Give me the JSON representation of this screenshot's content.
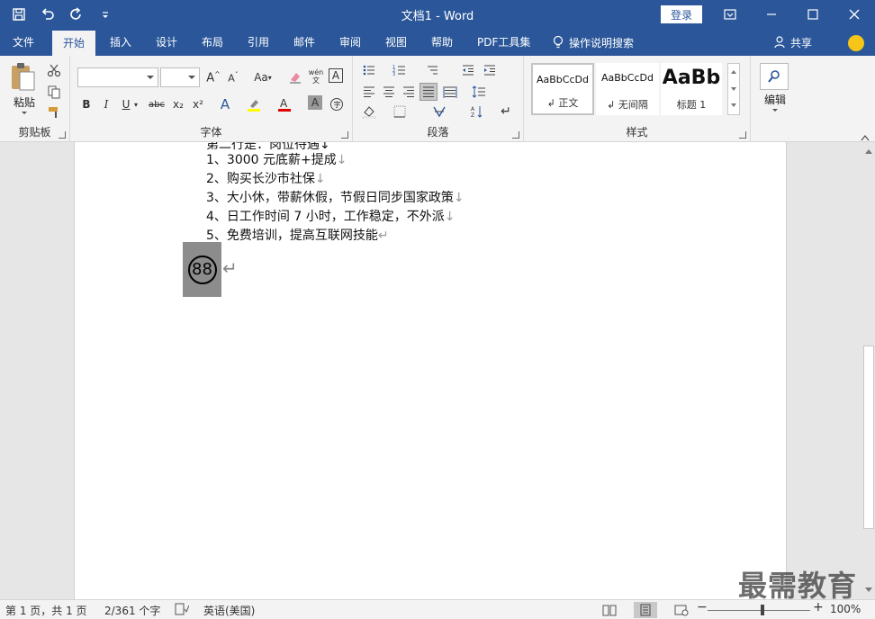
{
  "title_bar": {
    "title": "文档1  -  Word",
    "login_label": "登录"
  },
  "tabs": [
    "文件",
    "开始",
    "插入",
    "设计",
    "布局",
    "引用",
    "邮件",
    "审阅",
    "视图",
    "帮助",
    "PDF工具集"
  ],
  "active_tab": "开始",
  "tell_me": "操作说明搜索",
  "share_label": "共享",
  "ribbon": {
    "clipboard": {
      "paste_label": "粘贴",
      "group_label": "剪贴板"
    },
    "font": {
      "font_name": "",
      "font_size": "",
      "group_label": "字体",
      "aa_label": "Aa",
      "pinyin_label": "wén 文",
      "char_border": "A",
      "bold": "B",
      "italic": "I",
      "underline": "U",
      "strike": "abc",
      "subscript": "x₂",
      "superscript": "x²"
    },
    "paragraph": {
      "group_label": "段落"
    },
    "styles": {
      "group_label": "样式",
      "items": [
        {
          "sample": "AaBbCcDd",
          "name": "↲ 正文"
        },
        {
          "sample": "AaBbCcDd",
          "name": "↲ 无间隔"
        },
        {
          "sample": "AaBb",
          "name": "标题 1"
        }
      ]
    },
    "editing": {
      "label": "编辑"
    }
  },
  "document": {
    "cut_line": "第二行是：岗位待遇↓",
    "lines": [
      {
        "text": "1、3000 元底薪+提成",
        "mark": "↓"
      },
      {
        "text": "2、购买长沙市社保",
        "mark": "↓"
      },
      {
        "text": "3、大小休，带薪休假，节假日同步国家政策",
        "mark": "↓"
      },
      {
        "text": "4、日工作时间 7 小时，工作稳定，不外派",
        "mark": "↓"
      },
      {
        "text": "5、免费培训，提高互联网技能",
        "mark": "↵"
      }
    ],
    "enclosed_char": "88",
    "enclosed_mark": "↵"
  },
  "watermark": "最需教育",
  "status_bar": {
    "page": "第 1 页，共 1 页",
    "words": "2/361 个字",
    "language": "英语(美国)",
    "zoom": "100%",
    "zoom_minus": "−",
    "zoom_plus": "+"
  }
}
